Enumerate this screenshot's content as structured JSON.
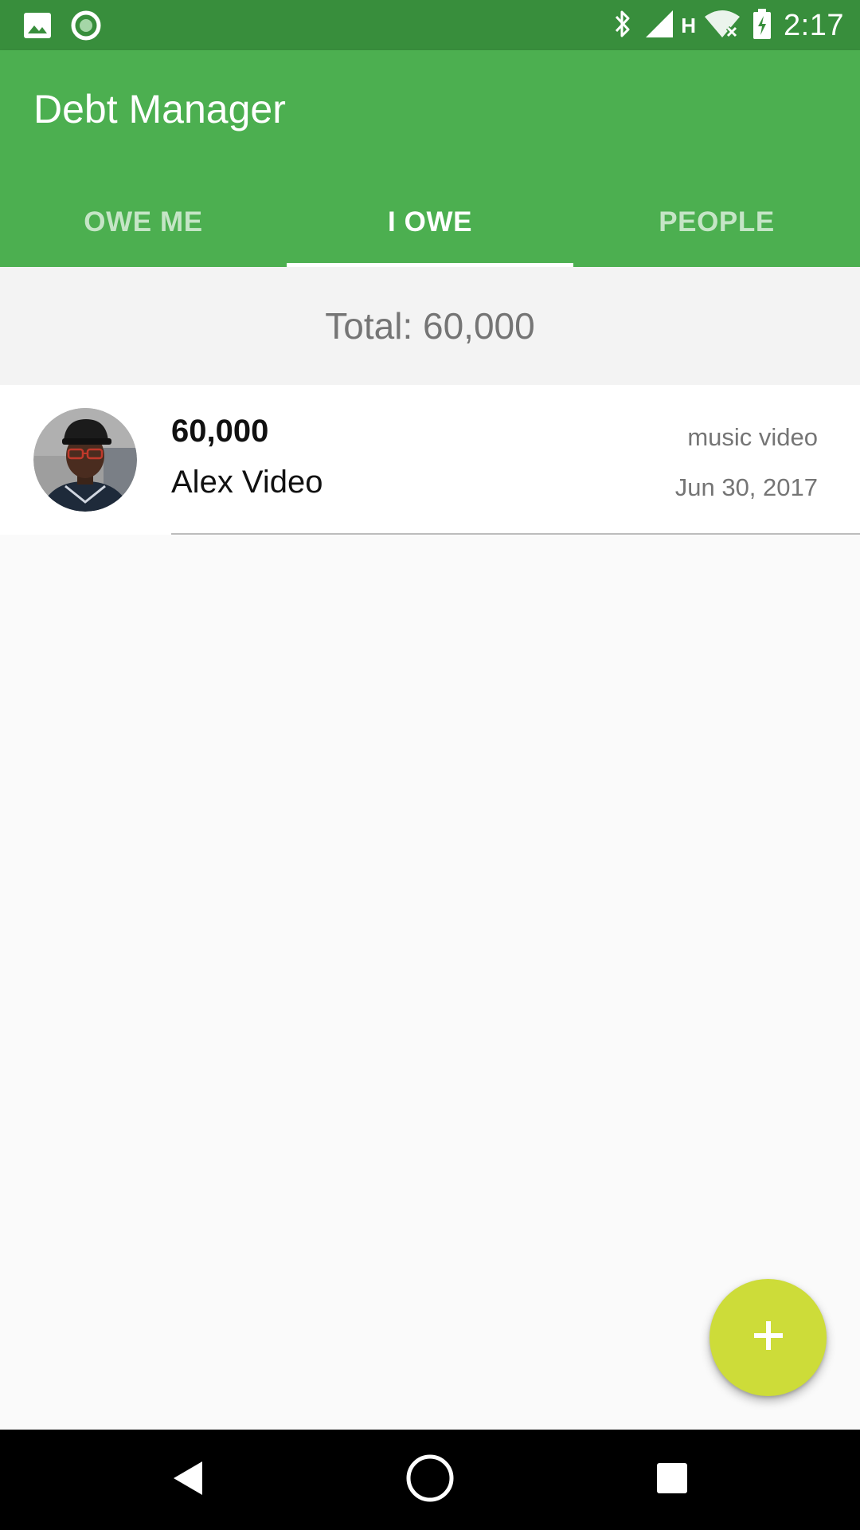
{
  "status_bar": {
    "time": "2:17",
    "network_label": "H",
    "left_icons": [
      "image-icon",
      "sync-circle-icon"
    ],
    "right_icons": [
      "bluetooth-icon",
      "cell-signal-icon",
      "wifi-off-icon",
      "battery-charging-icon"
    ]
  },
  "app_bar": {
    "title": "Debt Manager",
    "color": "#4caf50",
    "status_color": "#388e3c"
  },
  "tabs": [
    {
      "label": "OWE ME",
      "active": false
    },
    {
      "label": "I OWE",
      "active": true
    },
    {
      "label": "PEOPLE",
      "active": false
    }
  ],
  "summary": {
    "total_text": "Total: 60,000"
  },
  "debts": [
    {
      "amount": "60,000",
      "name": "Alex Video",
      "description": "music video",
      "date": "Jun 30, 2017"
    }
  ],
  "fab": {
    "icon": "plus-icon",
    "color": "#cddc39"
  },
  "nav_bar": {
    "icons": [
      "back-icon",
      "home-icon",
      "recents-icon"
    ]
  }
}
